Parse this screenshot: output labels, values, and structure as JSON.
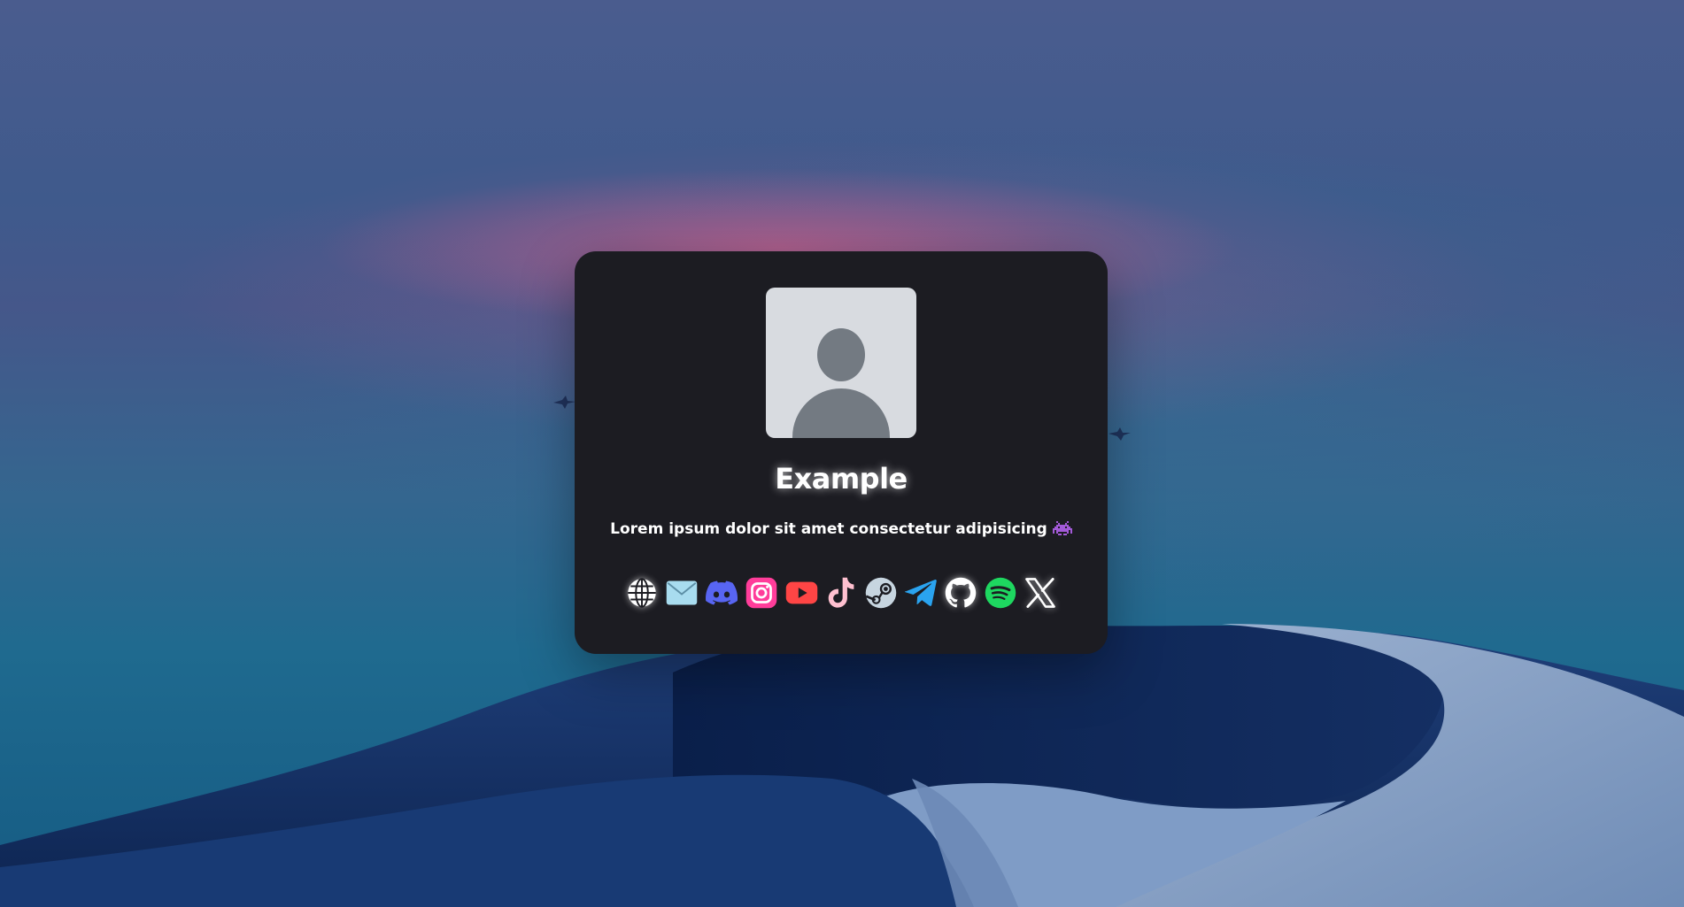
{
  "profile": {
    "name": "Example",
    "bio": "Lorem ipsum dolor sit amet consectetur adipisicing",
    "bio_emoji": "space-invader-icon",
    "avatar_icon": "default-user-avatar"
  },
  "socials": [
    {
      "id": "website",
      "icon": "globe-icon",
      "color": "#ffffff"
    },
    {
      "id": "email",
      "icon": "mail-icon",
      "color": "#a8dcef"
    },
    {
      "id": "discord",
      "icon": "discord-icon",
      "color": "#5865f2"
    },
    {
      "id": "instagram",
      "icon": "instagram-icon",
      "color": "#ff3d9a"
    },
    {
      "id": "youtube",
      "icon": "youtube-icon",
      "color": "#ff4545"
    },
    {
      "id": "tiktok",
      "icon": "tiktok-icon",
      "color": "#ffc0d0"
    },
    {
      "id": "steam",
      "icon": "steam-icon",
      "color": "#c7d5e0"
    },
    {
      "id": "telegram",
      "icon": "telegram-icon",
      "color": "#2aa3ef"
    },
    {
      "id": "github",
      "icon": "github-icon",
      "color": "#ffffff"
    },
    {
      "id": "spotify",
      "icon": "spotify-icon",
      "color": "#1ed760"
    },
    {
      "id": "x",
      "icon": "x-icon",
      "color": "#ffffff"
    }
  ],
  "colors": {
    "card_background": "#1c1c22",
    "avatar_background": "#d8dbe0",
    "avatar_silhouette": "#737a82"
  }
}
